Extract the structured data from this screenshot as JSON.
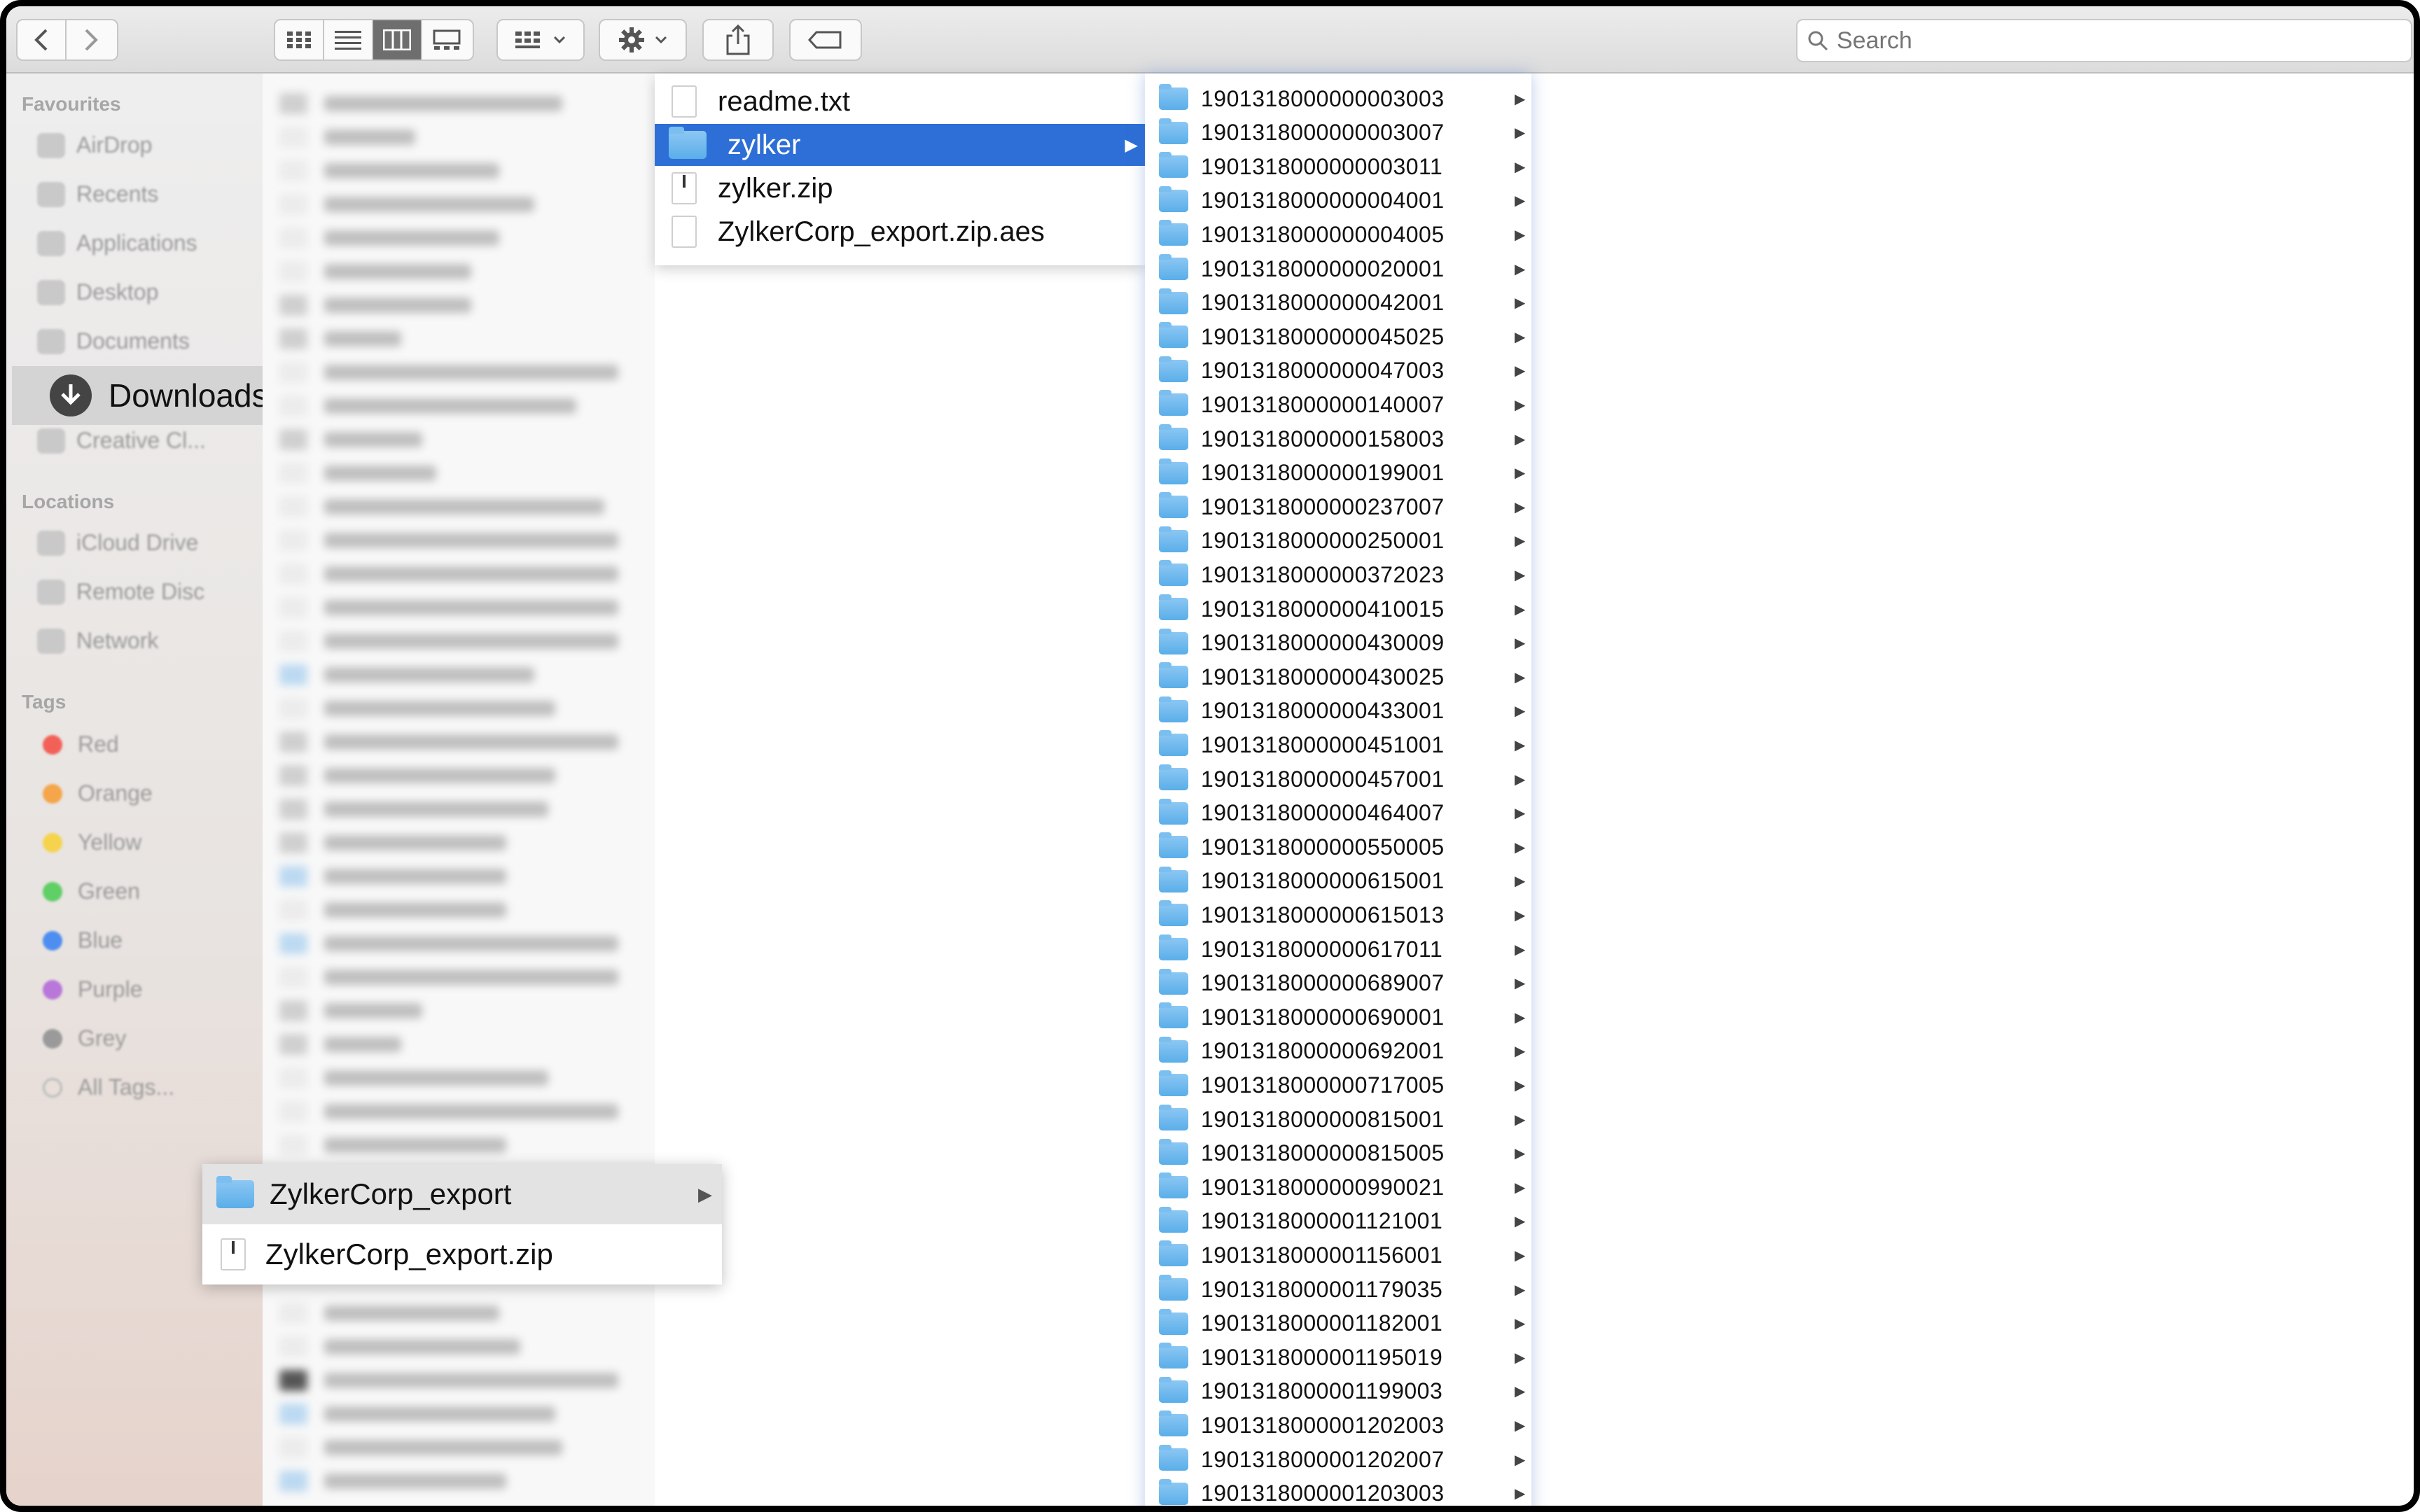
{
  "toolbar": {
    "search_placeholder": "Search"
  },
  "sidebar": {
    "favourites_header": "Favourites",
    "favourites": [
      "AirDrop",
      "Recents",
      "Applications",
      "Desktop",
      "Documents",
      "Downloads",
      "Creative Cl..."
    ],
    "selected": "Downloads",
    "locations_header": "Locations",
    "locations": [
      "iCloud Drive",
      "Remote Disc",
      "Network"
    ],
    "tags_header": "Tags",
    "tags": [
      {
        "label": "Red",
        "color": "#f26158"
      },
      {
        "label": "Orange",
        "color": "#f5a54a"
      },
      {
        "label": "Yellow",
        "color": "#f5d34d"
      },
      {
        "label": "Green",
        "color": "#5fcf66"
      },
      {
        "label": "Blue",
        "color": "#4d8ef0"
      },
      {
        "label": "Purple",
        "color": "#b877d9"
      },
      {
        "label": "Grey",
        "color": "#9a9a9a"
      },
      {
        "label": "All Tags...",
        "color": ""
      }
    ]
  },
  "column2": {
    "items": [
      {
        "name": "readme.txt",
        "kind": "file"
      },
      {
        "name": "zylker",
        "kind": "folder"
      },
      {
        "name": "zylker.zip",
        "kind": "zip"
      },
      {
        "name": "ZylkerCorp_export.zip.aes",
        "kind": "file"
      }
    ],
    "selected_index": 1
  },
  "column3": {
    "folders": [
      "1901318000000003003",
      "1901318000000003007",
      "1901318000000003011",
      "1901318000000004001",
      "1901318000000004005",
      "1901318000000020001",
      "1901318000000042001",
      "1901318000000045025",
      "1901318000000047003",
      "1901318000000140007",
      "1901318000000158003",
      "1901318000000199001",
      "1901318000000237007",
      "1901318000000250001",
      "1901318000000372023",
      "1901318000000410015",
      "1901318000000430009",
      "1901318000000430025",
      "1901318000000433001",
      "1901318000000451001",
      "1901318000000457001",
      "1901318000000464007",
      "1901318000000550005",
      "1901318000000615001",
      "1901318000000615013",
      "1901318000000617011",
      "1901318000000689007",
      "1901318000000690001",
      "1901318000000692001",
      "1901318000000717005",
      "1901318000000815001",
      "1901318000000815005",
      "1901318000000990021",
      "1901318000001121001",
      "1901318000001156001",
      "1901318000001179035",
      "1901318000001182001",
      "1901318000001195019",
      "1901318000001199003",
      "1901318000001202003",
      "1901318000001202007",
      "1901318000001203003"
    ]
  },
  "popup": {
    "items": [
      {
        "name": "ZylkerCorp_export",
        "kind": "folder"
      },
      {
        "name": "ZylkerCorp_export.zip",
        "kind": "zip"
      }
    ]
  },
  "colors": {
    "selection": "#2d6fd6",
    "folder": "#5aaee9"
  }
}
